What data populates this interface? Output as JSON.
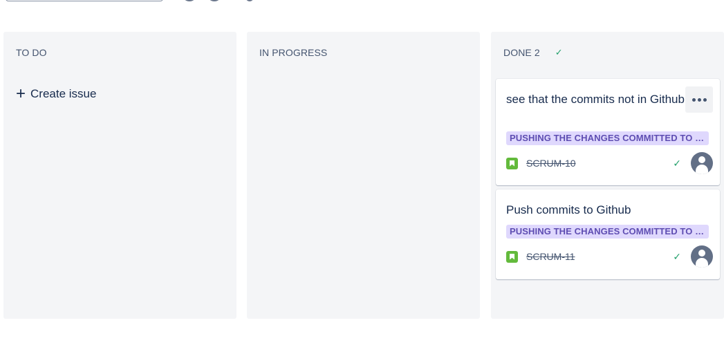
{
  "columns": {
    "todo": {
      "title": "TO DO",
      "create_label": "Create issue"
    },
    "in_progress": {
      "title": "IN PROGRESS"
    },
    "done": {
      "title": "DONE 2"
    }
  },
  "cards": [
    {
      "title": "see that the commits not in Github",
      "epic": "PUSHING THE CHANGES COMMITTED TO G...",
      "key": "SCRUM-10",
      "type_icon": "story-icon",
      "status_icon": "check-icon",
      "assignee_icon": "unassigned-avatar-icon"
    },
    {
      "title": "Push commits to Github",
      "epic": "PUSHING THE CHANGES COMMITTED TO G...",
      "key": "SCRUM-11",
      "type_icon": "story-icon",
      "status_icon": "check-icon",
      "assignee_icon": "unassigned-avatar-icon"
    }
  ],
  "colors": {
    "column_bg": "#f4f5f7",
    "epic_bg": "#dfd8fd",
    "epic_text": "#5e4db2",
    "story_green": "#63ba3c",
    "done_green": "#22a06b"
  }
}
